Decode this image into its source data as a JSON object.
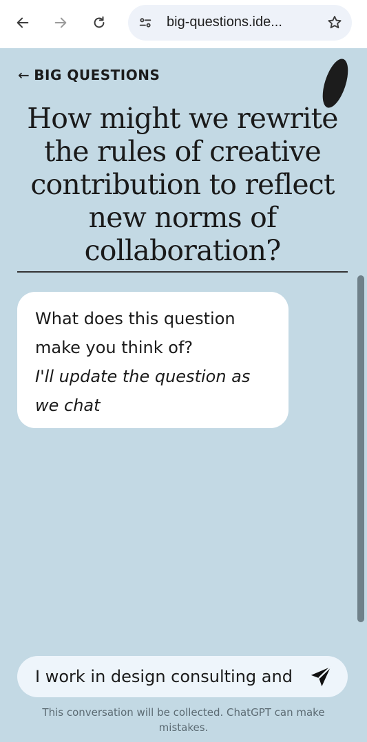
{
  "browser": {
    "url": "big-questions.ide...",
    "icons": [
      "back-arrow-icon",
      "forward-arrow-icon",
      "reload-icon",
      "site-info-icon",
      "bookmark-star-icon"
    ]
  },
  "header": {
    "back_arrow": "←",
    "back_label": "BIG QUESTIONS"
  },
  "main": {
    "question": "How might we rewrite the rules of creative contribution to reflect new norms of collaboration?"
  },
  "chat": {
    "bubble_question": "What does this question make you think of?",
    "bubble_note": "I'll update the question as we chat"
  },
  "composer": {
    "value": "I work in design consulting and",
    "send_icon": "paper-plane-icon"
  },
  "footer": {
    "disclaimer": "This conversation will be collected. ChatGPT can make mistakes."
  },
  "colors": {
    "page_bg": "#c3d9e4",
    "bubble_bg": "#ffffff",
    "input_bg": "#eef5fb",
    "text": "#1b1b1b",
    "scrollbar": "#6f8089"
  }
}
